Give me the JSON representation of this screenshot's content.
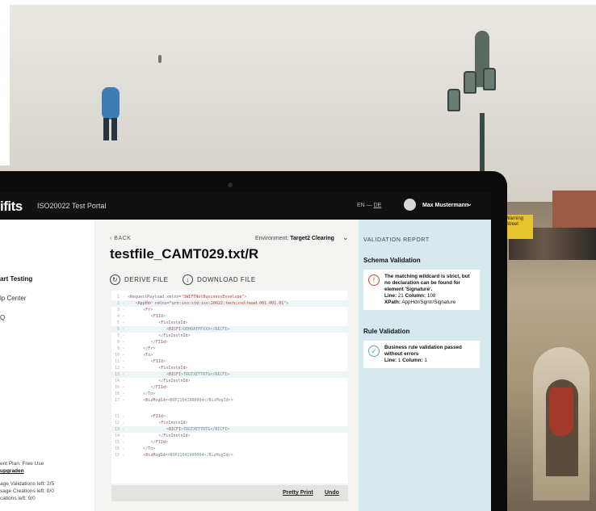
{
  "app": {
    "logo": "ifits",
    "portal_name": "ISO20022 Test Portal",
    "lang_en": "EN",
    "lang_sep": " — ",
    "lang_de": "DE",
    "user_name": "Max Mustermann"
  },
  "sidebar": {
    "items": [
      {
        "label": "art Testing",
        "active": true
      },
      {
        "label": "lp Center",
        "active": false
      },
      {
        "label": "Q",
        "active": false
      }
    ],
    "plan_label": "ent Plan: Free Use",
    "upgrade_link": "upgraden",
    "validations_left": "age Validations left: 2/5",
    "creations_left": "sage Creations left: 0/0",
    "other_left": "cations left: 0/0"
  },
  "main": {
    "back": "BACK",
    "environment_label": "Environment:",
    "environment_value": "Target2 Clearing",
    "file_title": "testfile_CAMT029.txt/R",
    "derive_file": "DERIVE FILE",
    "download_file": "DOWNLOAD FILE",
    "pretty_print": "Pretty Print",
    "undo": "Undo"
  },
  "code_lines": [
    {
      "n": "1",
      "indent": 0,
      "pre": "<",
      "tag": "RequestPayload xmlns=",
      "val": "\"SWIFTNetBusinessEnvelope\"",
      "post": ">"
    },
    {
      "n": "2",
      "indent": 3,
      "pre": "<",
      "tag": "AppHdr xmlns=",
      "val": "\"urn:iso:std:iso:20022:tech:xsd:head.001.001.01\"",
      "post": ">"
    },
    {
      "n": "3",
      "indent": 6,
      "pre": "<",
      "tag": "Fr",
      "val": "",
      "post": ">"
    },
    {
      "n": "4",
      "indent": 9,
      "pre": "<",
      "tag": "FIId",
      "val": "",
      "post": ">"
    },
    {
      "n": "5",
      "indent": 12,
      "pre": "<",
      "tag": "FinInstnId",
      "val": "",
      "post": ">"
    },
    {
      "n": "6",
      "indent": 15,
      "pre": "<",
      "tag": "BICFI",
      "val": "",
      "post": ">DEHOATPFXXX</BICFI>"
    },
    {
      "n": "7",
      "indent": 12,
      "pre": "</",
      "tag": "FinInstnId",
      "val": "",
      "post": ">"
    },
    {
      "n": "8",
      "indent": 9,
      "pre": "</",
      "tag": "FIId",
      "val": "",
      "post": ">"
    },
    {
      "n": "9",
      "indent": 6,
      "pre": "</",
      "tag": "Fr",
      "val": "",
      "post": ">"
    },
    {
      "n": "10",
      "indent": 6,
      "pre": "<",
      "tag": "To",
      "val": "",
      "post": ">"
    },
    {
      "n": "11",
      "indent": 9,
      "pre": "<",
      "tag": "FIId",
      "val": "",
      "post": ">"
    },
    {
      "n": "12",
      "indent": 12,
      "pre": "<",
      "tag": "FinInstnId",
      "val": "",
      "post": ">"
    },
    {
      "n": "13",
      "indent": 15,
      "pre": "<",
      "tag": "BICFI",
      "val": "",
      "post": ">TRGTXETTRTG</BICFI>"
    },
    {
      "n": "14",
      "indent": 12,
      "pre": "</",
      "tag": "FinInstnId",
      "val": "",
      "post": ">"
    },
    {
      "n": "15",
      "indent": 9,
      "pre": "</",
      "tag": "FIId",
      "val": "",
      "post": ">"
    },
    {
      "n": "16",
      "indent": 6,
      "pre": "</",
      "tag": "To",
      "val": "",
      "post": ">"
    },
    {
      "n": "17",
      "indent": 6,
      "pre": "<",
      "tag": "BizMsgIdr",
      "val": "",
      "post": ">BOP21041900004</BizMsgIdr>"
    },
    {
      "n": "11",
      "indent": 9,
      "pre": "<",
      "tag": "FIId",
      "val": "",
      "post": ">"
    },
    {
      "n": "12",
      "indent": 12,
      "pre": "<",
      "tag": "FinInstnId",
      "val": "",
      "post": ">"
    },
    {
      "n": "13",
      "indent": 15,
      "pre": "<",
      "tag": "BICFI",
      "val": "",
      "post": ">TRGTXETTRTG</BICFI>"
    },
    {
      "n": "14",
      "indent": 12,
      "pre": "</",
      "tag": "FinInstnId",
      "val": "",
      "post": ">"
    },
    {
      "n": "15",
      "indent": 9,
      "pre": "</",
      "tag": "FIId",
      "val": "",
      "post": ">"
    },
    {
      "n": "16",
      "indent": 6,
      "pre": "</",
      "tag": "To",
      "val": "",
      "post": ">"
    },
    {
      "n": "17",
      "indent": 6,
      "pre": "<",
      "tag": "BizMsgIdr",
      "val": "",
      "post": ">BOP21041900004</BizMsgIdr>"
    }
  ],
  "highlighted_lines": [
    1,
    5,
    12,
    19
  ],
  "report": {
    "title": "VALIDATION REPORT",
    "schema_heading": "Schema Validation",
    "schema_msg": "The matching wildcard is strict, but no declaration can be found for element 'Signature'.",
    "schema_line_label": "Line:",
    "schema_line": "21",
    "schema_col_label": "Column:",
    "schema_col": "108",
    "schema_xpath_label": "XPath:",
    "schema_xpath": "AppHdr/Sgntr/Signature",
    "rule_heading": "Rule Validation",
    "rule_msg": "Business rule validation passed without errors",
    "rule_line_label": "Line:",
    "rule_line": "1",
    "rule_col_label": "Column:",
    "rule_col": "1"
  },
  "background_sign": "Warning Street"
}
